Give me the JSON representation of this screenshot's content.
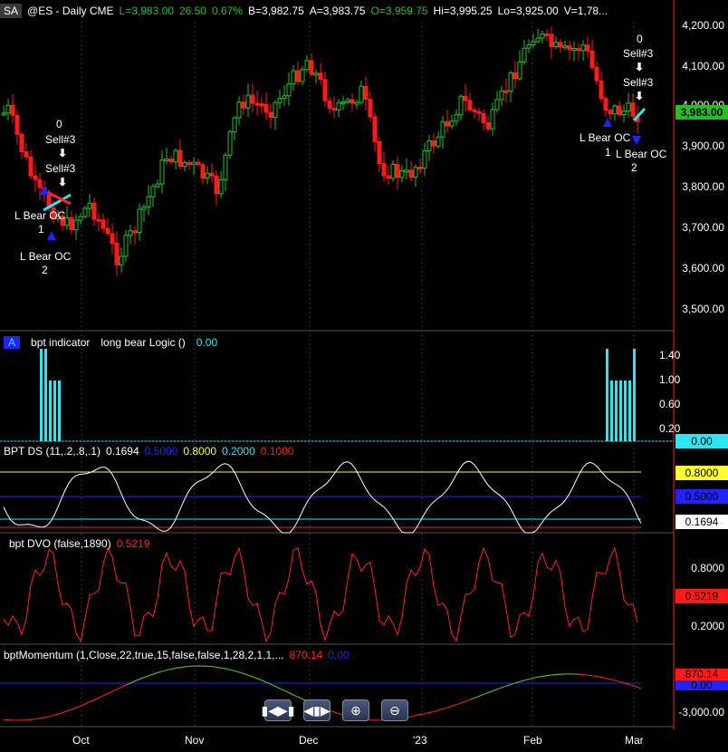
{
  "header": {
    "tag": "SA",
    "symbol": "@ES - Daily  CME",
    "last": "L=3,983.00",
    "change": "26.50",
    "pct": "0.67%",
    "bid": "B=3,982.75",
    "ask": "A=3,983.75",
    "open": "O=3,959.75",
    "hi": "Hi=3,995.25",
    "lo": "Lo=3,925.00",
    "vol": "V=1,78..."
  },
  "colors": {
    "up": "#22c022",
    "down": "#ff1a1a",
    "cyan": "#2ee6f0",
    "yellow": "#ffff33",
    "blue": "#2222ff",
    "red": "#ff2020",
    "green": "#33cc33"
  },
  "price_axis": [
    "4,200.00",
    "4,100.00",
    "4,000.00",
    "3,900.00",
    "3,800.00",
    "3,700.00",
    "3,600.00",
    "3,500.00"
  ],
  "price_tag": "3,983.00",
  "annotations": {
    "left_zero": "0",
    "left_sell1": "Sell#3",
    "left_sell2": "Sell#3",
    "left_lbear1": "L Bear OC",
    "left_lbear1_n": "1",
    "left_lbear2": "L Bear OC",
    "left_lbear2_n": "2",
    "right_zero": "0",
    "right_sell1": "Sell#3",
    "right_sell2": "Sell#3",
    "right_lbear1": "L Bear OC",
    "right_lbear1_n": "1",
    "right_lbear2": "L Bear OC",
    "right_lbear2_n": "2"
  },
  "pane_indicator": {
    "tag": "A",
    "name": "bpt  indicator",
    "logic": "long bear Logic ()",
    "value": "0.00",
    "axis": [
      "1.40",
      "1.00",
      "0.60",
      "0.20"
    ],
    "tag_value": "0.00"
  },
  "pane_ds": {
    "name": "BPT  DS (11,.2,.8,.1)",
    "v1": "0.1694",
    "v2": "0.5000",
    "v3": "0.8000",
    "v4": "0.2000",
    "v5": "0.1000",
    "tag_yellow": "0.8000",
    "tag_blue": "0.5000",
    "tag_white": "0.1694"
  },
  "pane_dvo": {
    "name": "bpt  DVO (false,1890)",
    "value": "0.5219",
    "axis": [
      "0.8000",
      "0.2000"
    ],
    "tag": "0.5219"
  },
  "pane_mom": {
    "name": "bptMomentum (1,Close,22,true,15,false,false,1,28,2,1,1,...",
    "value": "870.14",
    "value2": "0.00",
    "axis": [
      "-3,000.00"
    ],
    "tag_red": "870.14",
    "tag_blue": "0.00"
  },
  "x_axis": [
    "Oct",
    "Nov",
    "Dec",
    "'23",
    "Feb",
    "Mar"
  ],
  "toolbar": {
    "b1": "zoom-fit-icon",
    "b2": "zoom-range-icon",
    "b3": "zoom-in-icon",
    "b4": "zoom-out-icon"
  }
}
